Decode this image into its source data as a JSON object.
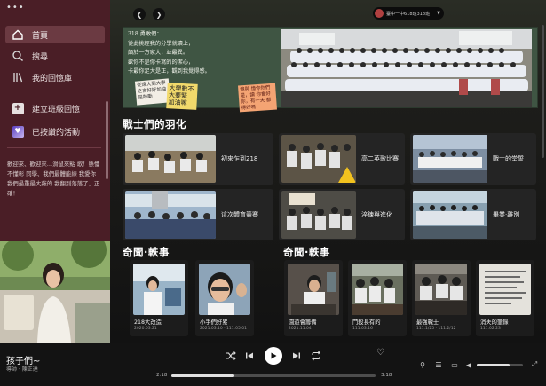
{
  "sidebar": {
    "menu_dots": "•••",
    "nav": {
      "home": "首頁",
      "search": "搜尋",
      "library": "我的回憶庫",
      "create": "建立班級回憶",
      "liked": "已按讚的活動"
    },
    "note": "歡迎來、歡迎來…滑鼠來點 歌！懸懂不懂彰 同學、我們最體能練 我愛你我們最重最大敲的 我翻到落落了，正確！"
  },
  "topbar": {
    "user_label": "臺中一中618班318班",
    "back_icon": "chevron-left-icon",
    "forward_icon": "chevron-right-icon"
  },
  "banner": {
    "poem": "318 勇敢們：\n  從此挑輕我的分學就讀上，\n  顛於一方家大，並最異。\n  歡你不是你卡寫的的潔心，\n  卡最你足大是正，觀到我覺得感。",
    "note1": "從遠大到大學 之言好好加油 是鼓勵",
    "note2": "大學數不 大要緊 加油嘛",
    "note3": "憶與 憶你你們是，讀 你會好你，有一天 都得好嗎"
  },
  "sections": {
    "feather": "戰士們的羽化",
    "left_story": "奇聞·軼事",
    "right_story": "奇聞·軼事"
  },
  "cards": [
    {
      "label": "初來乍到218"
    },
    {
      "label": "高二英歌比賽"
    },
    {
      "label": "戰士的堂誓"
    },
    {
      "label": "這次體育競賽"
    },
    {
      "label": "淬鍊與進化"
    },
    {
      "label": "畢業·離別"
    }
  ],
  "tiles": [
    {
      "name": "218大改造",
      "date": "2020.03.21"
    },
    {
      "name": "小手們好累",
      "date": "2021.03.10 · 111.05.01"
    },
    {
      "name": "園遊會籌備",
      "date": "2021.11.04"
    },
    {
      "name": "鬥殺長有的",
      "date": "111.03.16"
    },
    {
      "name": "最強戰士",
      "date": "111.1/25 · 111.2/12"
    },
    {
      "name": "消失的筆錄",
      "date": "111.02.23"
    }
  ],
  "player": {
    "title": "孩子們~",
    "artist": "導師 · 陳正達",
    "time_current": "2:18",
    "time_total": "3:18",
    "progress": 0.31,
    "volume": 0.72
  },
  "colors": {
    "sidebar_bg": "#4a1e26",
    "player_bg": "#131313",
    "chalkboard": "#3f5543"
  }
}
